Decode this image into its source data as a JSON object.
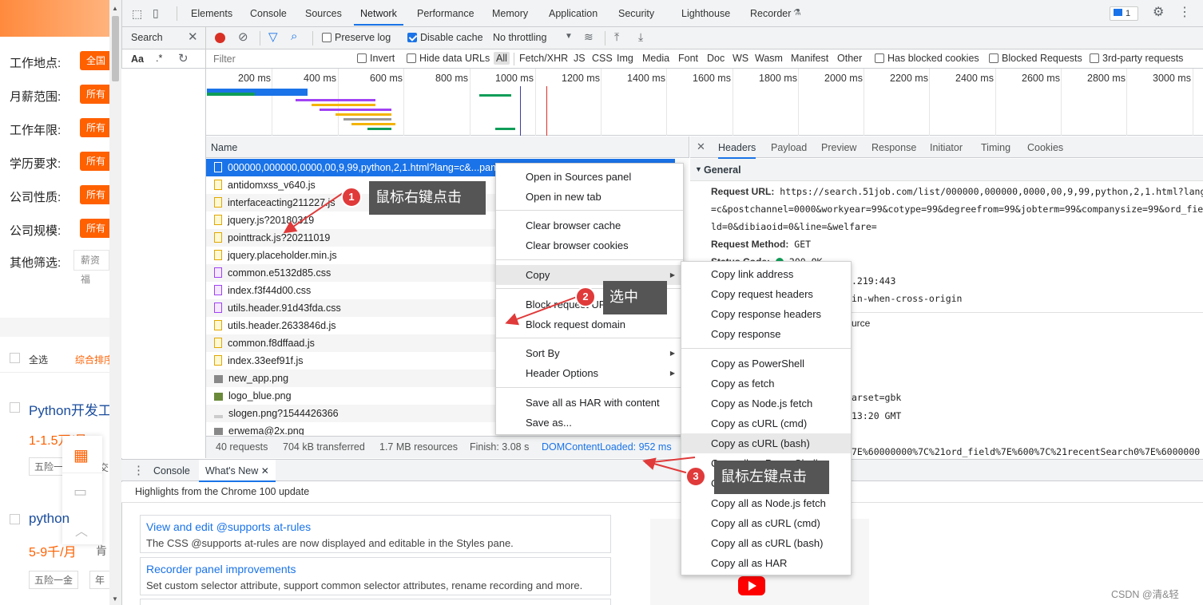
{
  "left_page": {
    "filters": [
      {
        "label": "工作地点:",
        "button": "全国"
      },
      {
        "label": "月薪范围:",
        "button": "所有"
      },
      {
        "label": "工作年限:",
        "button": "所有"
      },
      {
        "label": "学历要求:",
        "button": "所有"
      },
      {
        "label": "公司性质:",
        "button": "所有"
      },
      {
        "label": "公司规模:",
        "button": "所有"
      }
    ],
    "other_filter_label": "其他筛选:",
    "other_filter_value": "薪资福",
    "select_all": "全选",
    "sort_label": "综合排序",
    "job1_title": "Python开发工",
    "job1_salary": "1-1.5万/月",
    "job1_tag": "五险一",
    "job1_tag2": "交",
    "job2_title": "python",
    "job2_salary": "5-9千/月",
    "job2_extra": "肯",
    "job2_tag": "五险一金",
    "job2_tag2": "年"
  },
  "devtools": {
    "main_tabs": [
      "Elements",
      "Console",
      "Sources",
      "Network",
      "Performance",
      "Memory",
      "Application",
      "Security",
      "Lighthouse",
      "Recorder"
    ],
    "active_tab": "Network",
    "issues_count": "1",
    "search_label": "Search",
    "preserve_log": "Preserve log",
    "disable_cache": "Disable cache",
    "throttling": "No throttling",
    "filter_placeholder": "Filter",
    "invert": "Invert",
    "hide_data_urls": "Hide data URLs",
    "type_filters": [
      "All",
      "Fetch/XHR",
      "JS",
      "CSS",
      "Img",
      "Media",
      "Font",
      "Doc",
      "WS",
      "Wasm",
      "Manifest",
      "Other"
    ],
    "has_blocked_cookies": "Has blocked cookies",
    "blocked_requests": "Blocked Requests",
    "third_party": "3rd-party requests",
    "aa_label": "Aa",
    "regex_label": ".*",
    "timeline_labels": [
      "200 ms",
      "400 ms",
      "600 ms",
      "800 ms",
      "1000 ms",
      "1200 ms",
      "1400 ms",
      "1600 ms",
      "1800 ms",
      "2000 ms",
      "2200 ms",
      "2400 ms",
      "2600 ms",
      "2800 ms",
      "3000 ms"
    ],
    "name_header": "Name",
    "requests": [
      {
        "name": "000000,000000,0000,00,9,99,python,2,1.html?lang=c&...pany",
        "type": "doc"
      },
      {
        "name": "antidomxss_v640.js",
        "type": "js"
      },
      {
        "name": "interfaceacting211227.js",
        "type": "js"
      },
      {
        "name": "jquery.js?20180319",
        "type": "js"
      },
      {
        "name": "pointtrack.js?20211019",
        "type": "js"
      },
      {
        "name": "jquery.placeholder.min.js",
        "type": "js"
      },
      {
        "name": "common.e5132d85.css",
        "type": "css"
      },
      {
        "name": "index.f3f44d00.css",
        "type": "css"
      },
      {
        "name": "utils.header.91d43fda.css",
        "type": "css"
      },
      {
        "name": "utils.header.2633846d.js",
        "type": "js"
      },
      {
        "name": "common.f8dffaad.js",
        "type": "js"
      },
      {
        "name": "index.33eef91f.js",
        "type": "js"
      },
      {
        "name": "new_app.png",
        "type": "img"
      },
      {
        "name": "logo_blue.png",
        "type": "img"
      },
      {
        "name": "slogen.png?1544426366",
        "type": "img"
      },
      {
        "name": "erwema@2x.png",
        "type": "img"
      }
    ],
    "status_bar": [
      "40 requests",
      "704 kB transferred",
      "1.7 MB resources",
      "Finish: 3.08 s",
      "DOMContentLoaded: 952 ms"
    ],
    "detail_tabs": [
      "Headers",
      "Payload",
      "Preview",
      "Response",
      "Initiator",
      "Timing",
      "Cookies"
    ],
    "general_label": "General",
    "request_url_key": "Request URL:",
    "request_url_l1": "https://search.51job.com/list/000000,000000,0000,00,9,99,python,2,1.html?lang",
    "request_url_l2": "=c&postchannel=0000&workyear=99&cotype=99&degreefrom=99&jobterm=99&companysize=99&ord_fie",
    "request_url_l3": "ld=0&dibiaoid=0&line=&welfare=",
    "request_method_key": "Request Method:",
    "request_method_val": "GET",
    "status_code_partial": "Status Code:",
    "status_code_val": "200 OK",
    "remote_addr_partial": ".219:443",
    "referrer_partial": "in-when-cross-origin",
    "source_partial": "urce",
    "charset_partial": "arset=gbk",
    "date_partial": "13:20 GMT",
    "cookie_partial": "7E%60000000%7C%21ord_field%7E%600%7C%21recentSearch0%7E%6000000",
    "drawer_tabs": [
      "Console",
      "What's New"
    ],
    "highlights": "Highlights from the Chrome 100 update",
    "cards": [
      {
        "title": "View and edit @supports at-rules",
        "desc": "The CSS @supports at-rules are now displayed and editable in the Styles pane."
      },
      {
        "title": "Recorder panel improvements",
        "desc": "Set custom selector attribute, support common selector attributes, rename recording and more."
      }
    ]
  },
  "context_menu": {
    "items": [
      {
        "label": "Open in Sources panel"
      },
      {
        "label": "Open in new tab"
      },
      {
        "label": "Clear browser cache"
      },
      {
        "label": "Clear browser cookies"
      },
      {
        "label": "Copy"
      },
      {
        "label": "Block request URL"
      },
      {
        "label": "Block request domain"
      },
      {
        "label": "Sort By"
      },
      {
        "label": "Header Options"
      },
      {
        "label": "Save all as HAR with content"
      },
      {
        "label": "Save as..."
      }
    ]
  },
  "copy_submenu": {
    "items": [
      {
        "label": "Copy link address"
      },
      {
        "label": "Copy request headers"
      },
      {
        "label": "Copy response headers"
      },
      {
        "label": "Copy response"
      },
      {
        "label": "Copy as PowerShell"
      },
      {
        "label": "Copy as fetch"
      },
      {
        "label": "Copy as Node.js fetch"
      },
      {
        "label": "Copy as cURL (cmd)"
      },
      {
        "label": "Copy as cURL (bash)"
      },
      {
        "label": "Copy all as PowerShell"
      },
      {
        "label": "Copy all as fetch"
      },
      {
        "label": "Copy all as Node.js fetch"
      },
      {
        "label": "Copy all as cURL (cmd)"
      },
      {
        "label": "Copy all as cURL (bash)"
      },
      {
        "label": "Copy all as HAR"
      }
    ]
  },
  "annotations": [
    {
      "num": "1",
      "text": "鼠标右键点击"
    },
    {
      "num": "2",
      "text": "选中"
    },
    {
      "num": "3",
      "text": "鼠标左键点击"
    }
  ],
  "watermark": "CSDN @清&轻",
  "colors": {
    "accent": "#1a73e8",
    "orange": "#ff6000",
    "annotation_red": "#e03a3a",
    "callout_bg": "#555555"
  }
}
